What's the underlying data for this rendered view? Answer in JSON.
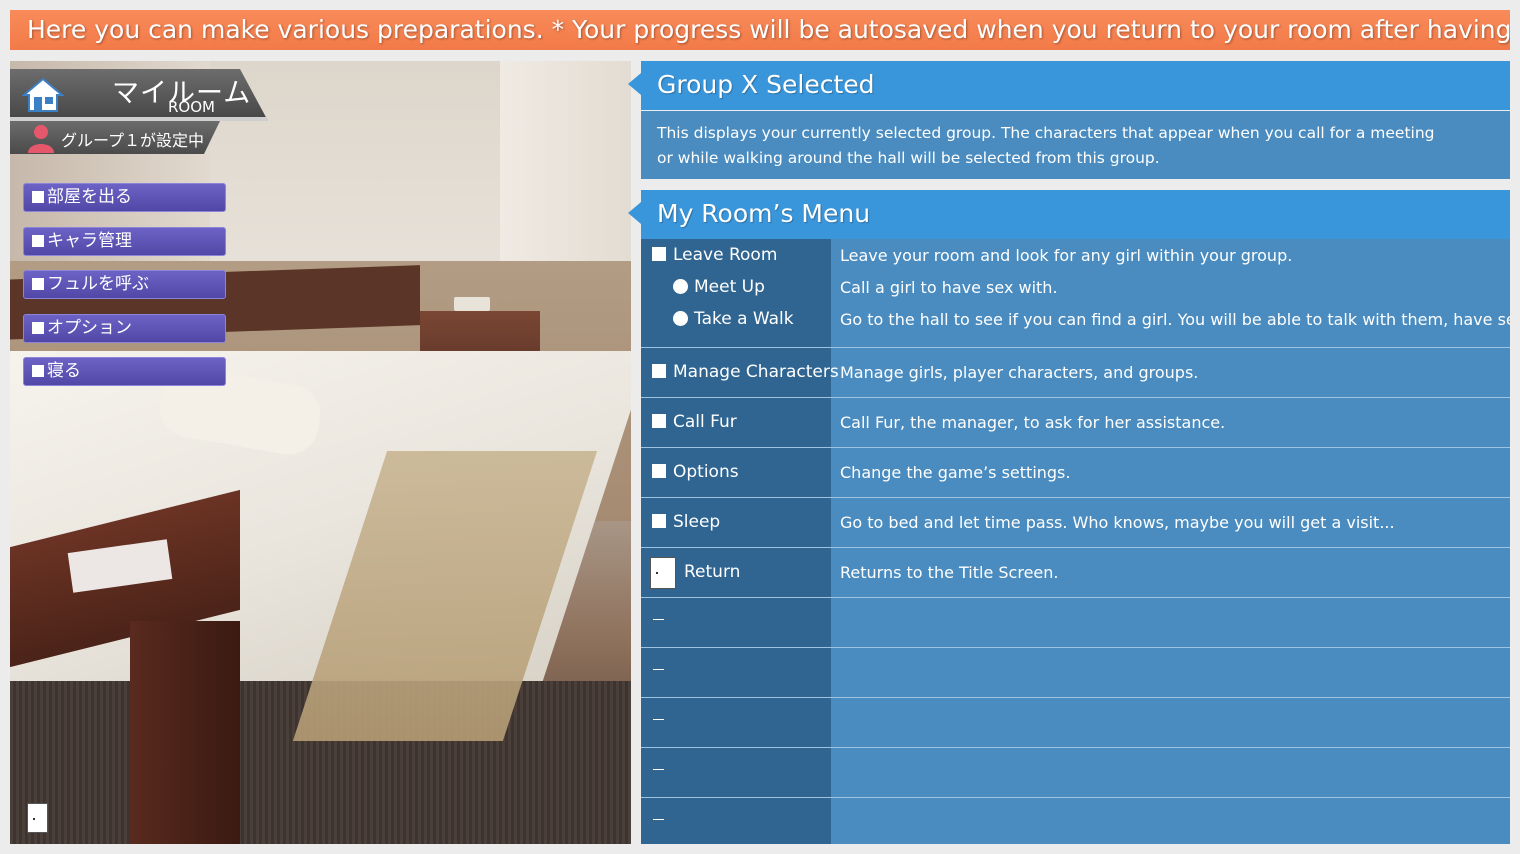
{
  "banner": {
    "text": "Here you can make various preparations. * Your progress will be autosaved when you return to your room after having sex."
  },
  "room": {
    "title_jp": "マイルーム",
    "title_en": "ROOM",
    "group_status": "グループ１が設定中",
    "menu": [
      {
        "label": "部屋を出る"
      },
      {
        "label": "キャラ管理"
      },
      {
        "label": "フュルを呼ぶ"
      },
      {
        "label": "オプション"
      },
      {
        "label": "寝る"
      }
    ]
  },
  "group_panel": {
    "title": "Group X Selected",
    "desc_line1": "This displays your currently selected group. The characters that appear when you call for a meeting",
    "desc_line2": "or while walking around the hall will be selected from this group."
  },
  "menu_panel": {
    "title": "My Room’s Menu",
    "leave": {
      "label": "Leave Room",
      "desc": "Leave your room and look for any girl within your group.",
      "sub": [
        {
          "label": "Meet Up",
          "desc": "Call a girl to have sex with."
        },
        {
          "label": "Take a Walk",
          "desc": "Go to the hall to see if you can find a girl. You will be able to talk with them, have sex..."
        }
      ]
    },
    "items": [
      {
        "label": "Manage Characters",
        "desc": "Manage girls, player characters, and groups."
      },
      {
        "label": "Call Fur",
        "desc": "Call Fur, the manager, to ask for her assistance."
      },
      {
        "label": "Options",
        "desc": "Change the game’s settings."
      },
      {
        "label": "Sleep",
        "desc": "Go to bed and let time pass. Who knows, maybe you will get a visit..."
      }
    ],
    "return": {
      "label": "Return",
      "desc": "Returns to the Title Screen."
    },
    "empty_rows": 5
  },
  "colors": {
    "banner": "#f27a48",
    "header_blue": "#3a96db",
    "row_dark": "#2f6590",
    "row_light": "#4a8cbf",
    "jp_button": "#5f55b8"
  },
  "icons": [
    "home-icon",
    "person-icon",
    "door-icon"
  ]
}
